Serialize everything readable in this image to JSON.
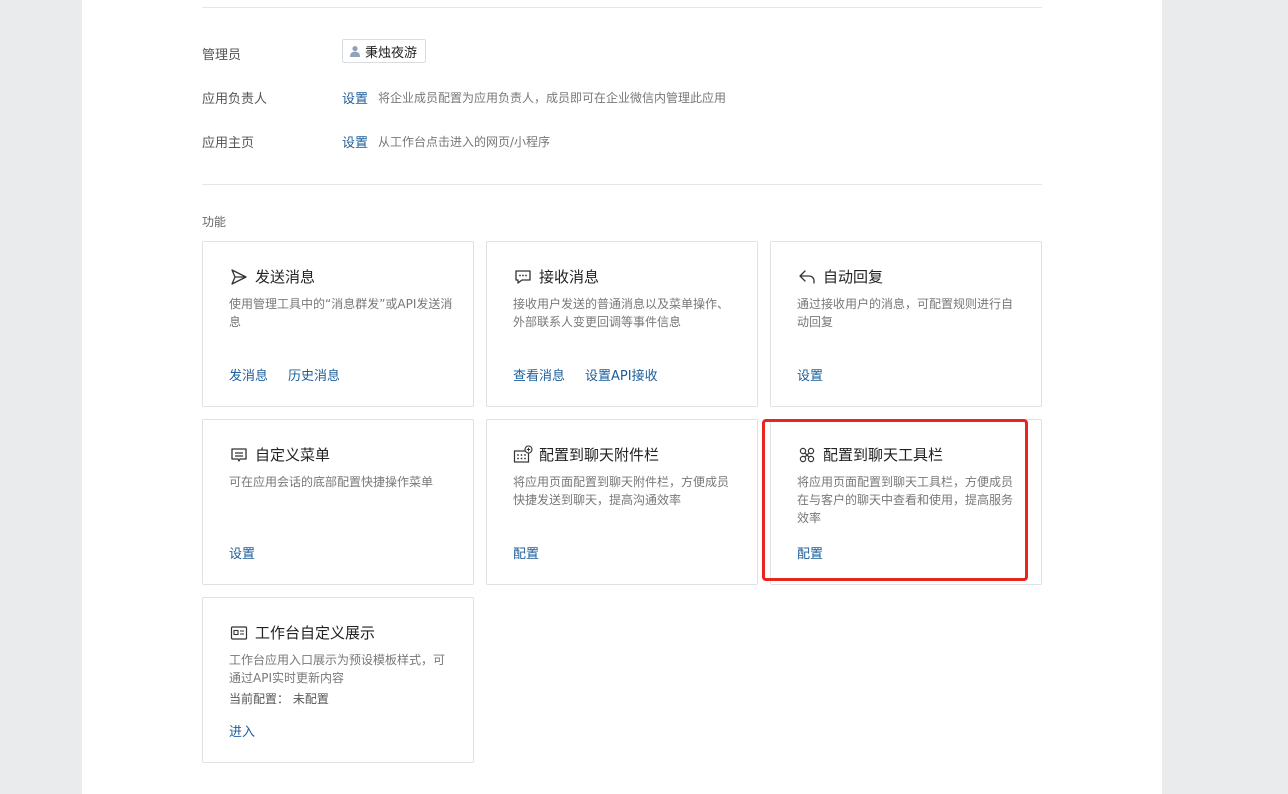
{
  "settings": {
    "admin": {
      "label": "管理员",
      "name": "秉烛夜游"
    },
    "owner": {
      "label": "应用负责人",
      "link": "设置",
      "desc": "将企业成员配置为应用负责人，成员即可在企业微信内管理此应用"
    },
    "homepage": {
      "label": "应用主页",
      "link": "设置",
      "desc": "从工作台点击进入的网页/小程序"
    }
  },
  "features": {
    "title": "功能",
    "cards": [
      {
        "icon": "send-icon",
        "title": "发送消息",
        "desc": "使用管理工具中的“消息群发”或API发送消息",
        "links": [
          "发消息",
          "历史消息"
        ]
      },
      {
        "icon": "message-icon",
        "title": "接收消息",
        "desc": "接收用户发送的普通消息以及菜单操作、外部联系人变更回调等事件信息",
        "links": [
          "查看消息",
          "设置API接收"
        ]
      },
      {
        "icon": "reply-icon",
        "title": "自动回复",
        "desc": "通过接收用户的消息，可配置规则进行自动回复",
        "links": [
          "设置"
        ]
      },
      {
        "icon": "menu-icon",
        "title": "自定义菜单",
        "desc": "可在应用会话的底部配置快捷操作菜单",
        "links": [
          "设置"
        ]
      },
      {
        "icon": "attachment-bar-icon",
        "title": "配置到聊天附件栏",
        "desc": "将应用页面配置到聊天附件栏，方便成员快捷发送到聊天，提高沟通效率",
        "links": [
          "配置"
        ]
      },
      {
        "icon": "toolbar-icon",
        "title": "配置到聊天工具栏",
        "desc": "将应用页面配置到聊天工具栏，方便成员在与客户的聊天中查看和使用，提高服务效率",
        "links": [
          "配置"
        ]
      },
      {
        "icon": "workbench-icon",
        "title": "工作台自定义展示",
        "desc": "工作台应用入口展示为预设模板样式，可通过API实时更新内容",
        "meta_label": "当前配置：",
        "meta_value": "未配置",
        "links": [
          "进入"
        ]
      }
    ]
  },
  "colors": {
    "link": "#1d5e9b",
    "highlight": "#e8251f",
    "background": "#eaebed"
  }
}
